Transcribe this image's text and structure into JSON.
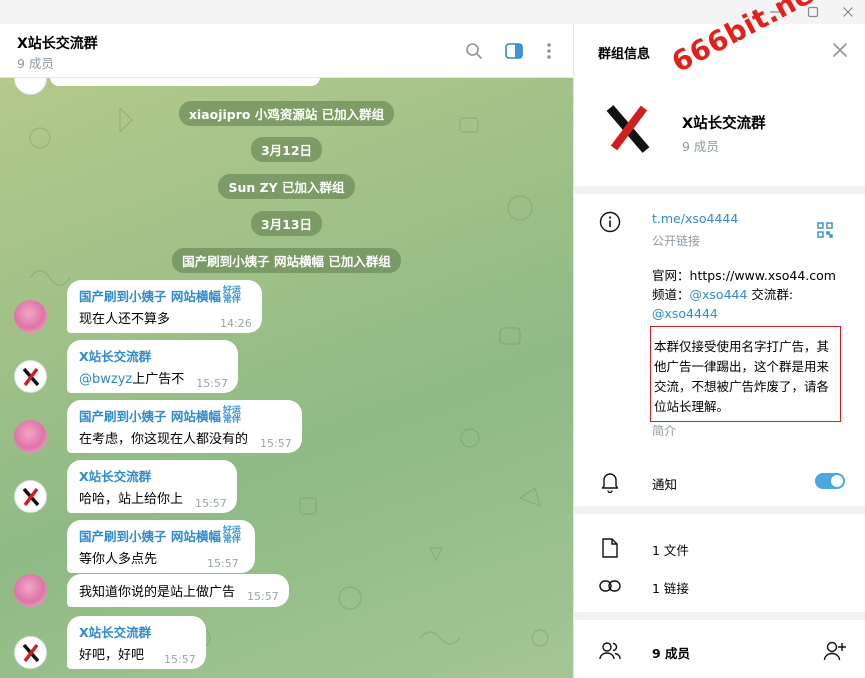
{
  "window": {
    "minimize_icon": "minimize-icon",
    "maximize_icon": "maximize-icon",
    "close_icon": "close-icon"
  },
  "chat": {
    "title": "X站长交流群",
    "members": "9 成员",
    "service_messages": [
      "xiaojipro 小鸡资源站 已加入群组",
      "3月12日",
      "Sun ZY 已加入群组",
      "3月13日",
      "国产刷到小姨子 网站横幅 已加入群组"
    ],
    "messages": [
      {
        "sender": "国产刷到小姨子 网站横幅",
        "badge_top": "好运",
        "badge_bottom": "常伴",
        "text": "现在人还不算多",
        "time": "14:26"
      },
      {
        "sender": "X站长交流群",
        "mention": "@bwzyz",
        "text": " 上广告不",
        "time": "15:57"
      },
      {
        "sender": "国产刷到小姨子 网站横幅",
        "badge_top": "好运",
        "badge_bottom": "常伴",
        "text": "在考虑，你这现在人都没有的",
        "time": "15:57"
      },
      {
        "sender": "X站长交流群",
        "text": "哈哈，站上给你上",
        "time": "15:57"
      },
      {
        "sender": "国产刷到小姨子 网站横幅",
        "badge_top": "好运",
        "badge_bottom": "常伴",
        "text": "等你人多点先",
        "time": "15:57"
      },
      {
        "text": "我知道你说的是站上做广告",
        "time": "15:57"
      },
      {
        "sender": "X站长交流群",
        "text": "好吧，好吧",
        "time": "15:57"
      }
    ]
  },
  "panel": {
    "title": "群组信息",
    "watermark": "666bit.net",
    "group_name": "X站长交流群",
    "group_members": "9 成员",
    "link": "t.me/xso4444",
    "link_label": "公开链接",
    "desc_line1_prefix": "官网：",
    "desc_line1_url": "https://www.xso44.com",
    "desc_line2_prefix": "频道：",
    "desc_line2_channel": "@xso444",
    "desc_line2_suffix": " 交流群:",
    "desc_line3_group": "@xso4444",
    "notice": "本群仅接受使用名字打广告，其他广告一律踢出，这个群是用来交流，不想被广告炸废了，请各位站长理解。",
    "desc_label": "简介",
    "notify_label": "通知",
    "notify_on": true,
    "files": "1 文件",
    "links": "1 链接",
    "members_row": "9 成员"
  },
  "colors": {
    "accent": "#2f8bce",
    "notice_border": "#d21f26",
    "watermark": "#e2211c",
    "toggle": "#4aa7e2"
  }
}
